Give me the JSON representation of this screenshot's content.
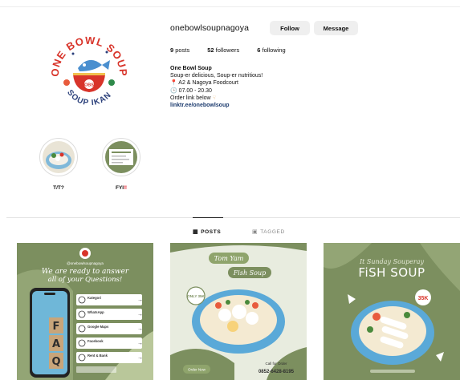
{
  "profile": {
    "username": "onebowlsoupnagoya",
    "follow_label": "Follow",
    "message_label": "Message",
    "stats": {
      "posts_count": "9",
      "posts_label": "posts",
      "followers_count": "52",
      "followers_label": "followers",
      "following_count": "6",
      "following_label": "following"
    },
    "bio": {
      "name": "One Bowl Soup",
      "line1": "Soup-er delicious, Soup-er nutritious!",
      "location": "A2 & Nagoya Foodcourt",
      "hours": "07.00 - 20.30",
      "order": "Order link below",
      "link": "linktr.ee/onebowlsoup"
    },
    "avatar": {
      "top_text": "ONE BOWL SOUP",
      "bottom_text": "SOUP IKAN",
      "badge": "OBS"
    }
  },
  "highlights": [
    {
      "label": "T/T?"
    },
    {
      "label": "FYI",
      "suffix": "‼"
    }
  ],
  "tabs": {
    "posts": "POSTS",
    "tagged": "TAGGED"
  },
  "posts": {
    "p1": {
      "handle": "@onebowlsoupnagoya",
      "heading1": "We are ready to answer",
      "heading2": "all of your Questions!",
      "faq": [
        "F",
        "A",
        "Q"
      ],
      "rows": [
        "Kategori",
        "WhatsApp",
        "Google Maps",
        "Facebook",
        "Rent & Bank"
      ]
    },
    "p2": {
      "title1": "Tom Yam",
      "title2": "Fish Soup",
      "badge": "ONLY 35K",
      "order": "Order Now",
      "call_label": "Call for Order",
      "phone": "0852-6428-8195"
    },
    "p3": {
      "script": "It Sunday Souperay",
      "title": "FiSH SOUP",
      "price": "35K"
    }
  },
  "colors": {
    "brand_green": "#7c8f5f",
    "light_green": "#b9c79a",
    "link_blue": "#1c3b6e",
    "button_gray": "#efefef",
    "red_accent": "#e01e2a"
  }
}
